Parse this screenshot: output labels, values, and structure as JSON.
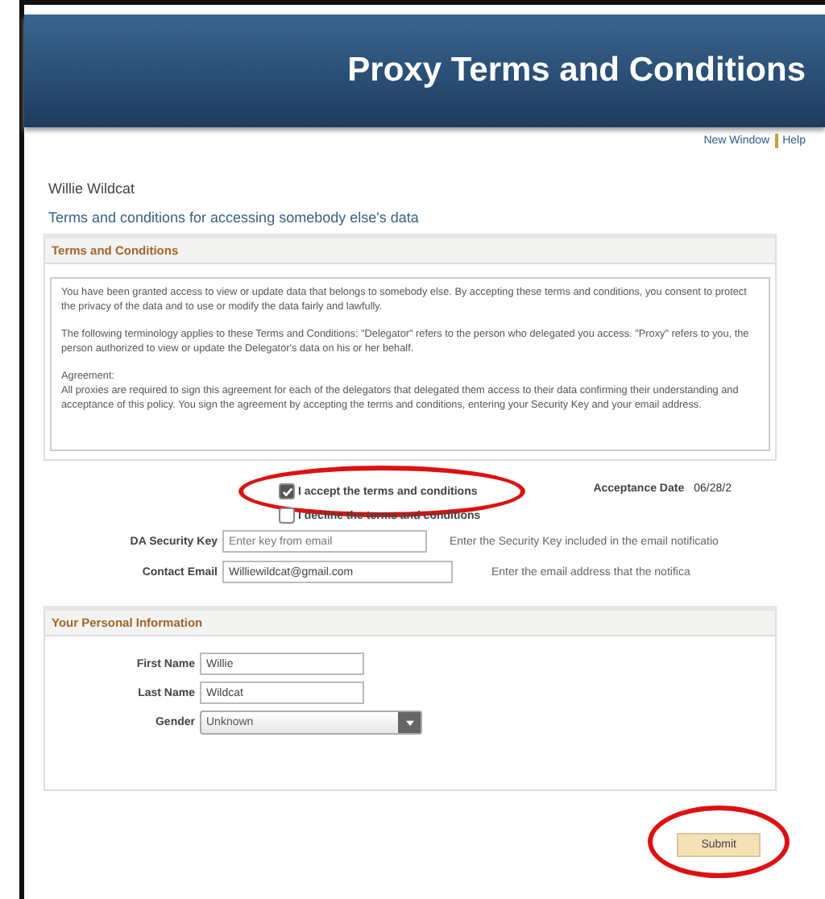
{
  "header": {
    "title": "Proxy Terms and Conditions"
  },
  "links": [
    {
      "label": "New Window"
    },
    {
      "label": "Help"
    }
  ],
  "user_name": "Willie Wildcat",
  "page_subtitle": "Terms and conditions for accessing somebody else's data",
  "terms_section": {
    "title": "Terms and Conditions",
    "paragraphs": [
      "You have been granted access to view or update data that belongs to somebody else. By accepting these terms and conditions, you consent to protect the privacy of the data and to use or modify the data fairly and lawfully.",
      "The following terminology applies to these Terms and Conditions: \"Delegator\" refers to the person who delegated you access.  \"Proxy\" refers to you, the person authorized to view or update the Delegator's data on his or her behalf.",
      "Agreement:",
      "All proxies are required to sign this agreement for each of the delegators that delegated them access to their data confirming their understanding and acceptance of this policy. You sign the agreement by accepting the terms and conditions, entering your Security Key and your email address."
    ]
  },
  "choices": [
    {
      "label": "I accept the terms and conditions",
      "checked": true,
      "circled": true
    },
    {
      "label": "I decline the terms and conditions",
      "checked": false,
      "circled": false
    }
  ],
  "acceptance_date": {
    "label": "Acceptance Date",
    "value": "06/28/2"
  },
  "fields": [
    {
      "label": "DA Security Key",
      "placeholder": "Enter key from email",
      "hint": "Enter the Security Key included in the email notificatio"
    },
    {
      "label": "Contact Email",
      "value": "Williewildcat@gmail.com",
      "hint": "Enter the email address that the notifica"
    }
  ],
  "personal_section": {
    "title": "Your Personal Information",
    "fields": [
      {
        "kind": "text",
        "label": "First Name",
        "value": "Willie"
      },
      {
        "kind": "text",
        "label": "Last Name",
        "value": "Wildcat"
      },
      {
        "kind": "select",
        "label": "Gender",
        "value": "Unknown"
      }
    ]
  },
  "submit": {
    "label": "Submit",
    "circled": true
  }
}
